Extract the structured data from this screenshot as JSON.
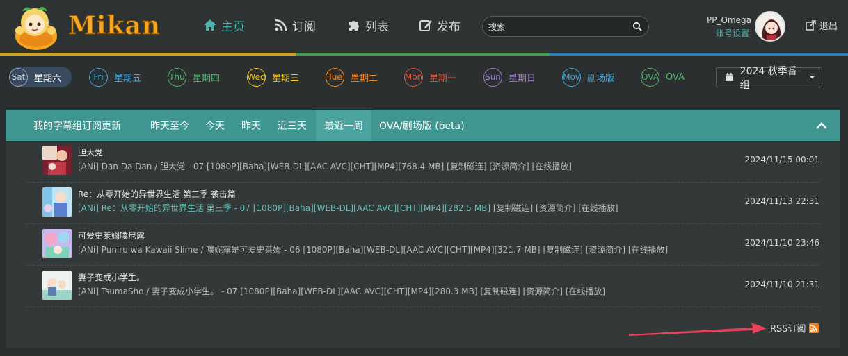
{
  "brand": {
    "name": "Mikan"
  },
  "nav": [
    {
      "label": "主页",
      "icon": "home-icon",
      "active": true
    },
    {
      "label": "订阅",
      "icon": "rss-icon",
      "active": false
    },
    {
      "label": "列表",
      "icon": "puzzle-icon",
      "active": false
    },
    {
      "label": "发布",
      "icon": "edit-icon",
      "active": false
    }
  ],
  "search": {
    "placeholder": "搜索"
  },
  "user": {
    "name": "PP_Omega",
    "settings_label": "账号设置",
    "logout_label": "退出"
  },
  "days": [
    {
      "abbr": "Sat",
      "label": "星期六",
      "color": "#9aa7b8",
      "active": true
    },
    {
      "abbr": "Fri",
      "label": "星期五",
      "color": "#4aa9d9"
    },
    {
      "abbr": "Thu",
      "label": "星期四",
      "color": "#56b36d"
    },
    {
      "abbr": "Wed",
      "label": "星期三",
      "color": "#f0c419"
    },
    {
      "abbr": "Tue",
      "label": "星期二",
      "color": "#ef8a2b"
    },
    {
      "abbr": "Mon",
      "label": "星期一",
      "color": "#e4543a"
    },
    {
      "abbr": "Sun",
      "label": "星期日",
      "color": "#9a7fc4"
    },
    {
      "abbr": "Mov",
      "label": "剧场版",
      "color": "#4aa9d9"
    },
    {
      "abbr": "OVA",
      "label": "OVA",
      "color": "#56b36d"
    }
  ],
  "season": {
    "label": "2024 秋季番组"
  },
  "panel": {
    "heading": "我的字幕组订阅更新",
    "tabs": [
      {
        "label": "昨天至今",
        "active": false
      },
      {
        "label": "今天",
        "active": false
      },
      {
        "label": "昨天",
        "active": false
      },
      {
        "label": "近三天",
        "active": false
      },
      {
        "label": "最近一周",
        "active": true
      },
      {
        "label": "OVA/剧场版 (beta)",
        "active": false
      }
    ]
  },
  "updates": [
    {
      "title": "胆大党",
      "release": "[ANi] Dan Da Dan / 胆大党 - 07 [1080P][Baha][WEB-DL][AAC AVC][CHT][MP4][768.4 MB]",
      "links": [
        "[复制磁连]",
        "[资源简介]",
        "[在线播放]"
      ],
      "date": "2024/11/15 00:01",
      "highlight": false
    },
    {
      "title": "Re：从零开始的异世界生活 第三季 袭击篇",
      "release": "[ANi] Re：从零开始的异世界生活 第三季 - 07 [1080P][Baha][WEB-DL][AAC AVC][CHT][MP4][282.5 MB]",
      "links": [
        "[复制磁连]",
        "[资源简介]",
        "[在线播放]"
      ],
      "date": "2024/11/13 22:31",
      "highlight": true
    },
    {
      "title": "可爱史莱姆噗尼露",
      "release": "[ANi] Puniru wa Kawaii Slime / 噗妮露是可爱史莱姆 - 06 [1080P][Baha][WEB-DL][AAC AVC][CHT][MP4][321.7 MB]",
      "links": [
        "[复制磁连]",
        "[资源简介]",
        "[在线播放]"
      ],
      "date": "2024/11/10 23:46",
      "highlight": false
    },
    {
      "title": "妻子变成小学生。",
      "release": "[ANi] TsumaSho / 妻子变成小学生。 - 07 [1080P][Baha][WEB-DL][AAC AVC][CHT][MP4][280.3 MB]",
      "links": [
        "[复制磁连]",
        "[资源简介]",
        "[在线播放]"
      ],
      "date": "2024/11/10 21:31",
      "highlight": false
    }
  ],
  "rss": {
    "label": "RSS订阅"
  },
  "colors": {
    "accent": "#4fb3ad",
    "panel_header": "#3f9691",
    "rss": "#f0811f",
    "arrow": "#e8415a"
  }
}
